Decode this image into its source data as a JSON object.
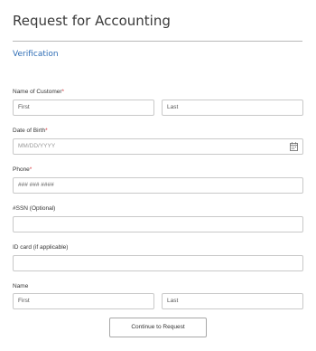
{
  "page": {
    "title": "Request for Accounting",
    "section": "Verification"
  },
  "form": {
    "customer_name": {
      "label": "Name of Customer",
      "required_mark": "*",
      "first_value": "First",
      "last_value": "Last"
    },
    "dob": {
      "label": "Date of Birth",
      "required_mark": "*",
      "placeholder": "MM/DD/YYYY",
      "icon": "calendar-icon"
    },
    "phone": {
      "label": "Phone",
      "required_mark": "*",
      "value": "### ### ####"
    },
    "ssn": {
      "label": "#SSN (Optional)",
      "value": ""
    },
    "id_card": {
      "label": "ID card (if applicable)",
      "value": ""
    },
    "name": {
      "label": "Name",
      "first_value": "First",
      "last_value": "Last"
    }
  },
  "actions": {
    "continue_label": "Continue to Request"
  },
  "colors": {
    "accent": "#2e6db5",
    "required": "#d9363e",
    "border": "#c9c9c9"
  }
}
